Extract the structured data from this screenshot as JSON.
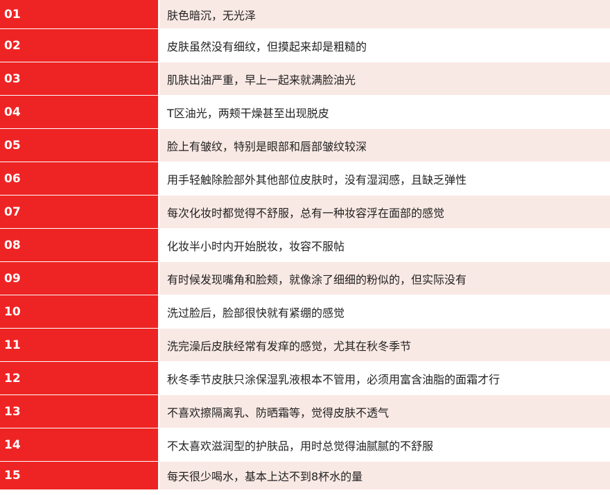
{
  "colors": {
    "number_cell": "#ee2424",
    "row_tint": "#f9e9e4",
    "row_plain": "#ffffff"
  },
  "rows": [
    {
      "num": "01",
      "text": "肤色暗沉，无光泽"
    },
    {
      "num": "02",
      "text": "皮肤虽然没有细纹，但摸起来却是粗糙的"
    },
    {
      "num": "03",
      "text": "肌肤出油严重，早上一起来就满脸油光"
    },
    {
      "num": "04",
      "text": "T区油光，两颊干燥甚至出现脱皮"
    },
    {
      "num": "05",
      "text": "脸上有皱纹，特别是眼部和唇部皱纹较深"
    },
    {
      "num": "06",
      "text": "用手轻触除脸部外其他部位皮肤时，没有湿润感，且缺乏弹性"
    },
    {
      "num": "07",
      "text": "每次化妆时都觉得不舒服，总有一种妆容浮在面部的感觉"
    },
    {
      "num": "08",
      "text": "化妆半小时内开始脱妆，妆容不服帖"
    },
    {
      "num": "09",
      "text": "有时候发现嘴角和脸颊，就像涂了细细的粉似的，但实际没有"
    },
    {
      "num": "10",
      "text": "洗过脸后，脸部很快就有紧绷的感觉"
    },
    {
      "num": "11",
      "text": "洗完澡后皮肤经常有发痒的感觉，尤其在秋冬季节"
    },
    {
      "num": "12",
      "text": "秋冬季节皮肤只涂保湿乳液根本不管用，必须用富含油脂的面霜才行"
    },
    {
      "num": "13",
      "text": "不喜欢擦隔离乳、防晒霜等，觉得皮肤不透气"
    },
    {
      "num": "14",
      "text": "不太喜欢滋润型的护肤品，用时总觉得油腻腻的不舒服"
    },
    {
      "num": "15",
      "text": "每天很少喝水，基本上达不到8杯水的量"
    }
  ]
}
